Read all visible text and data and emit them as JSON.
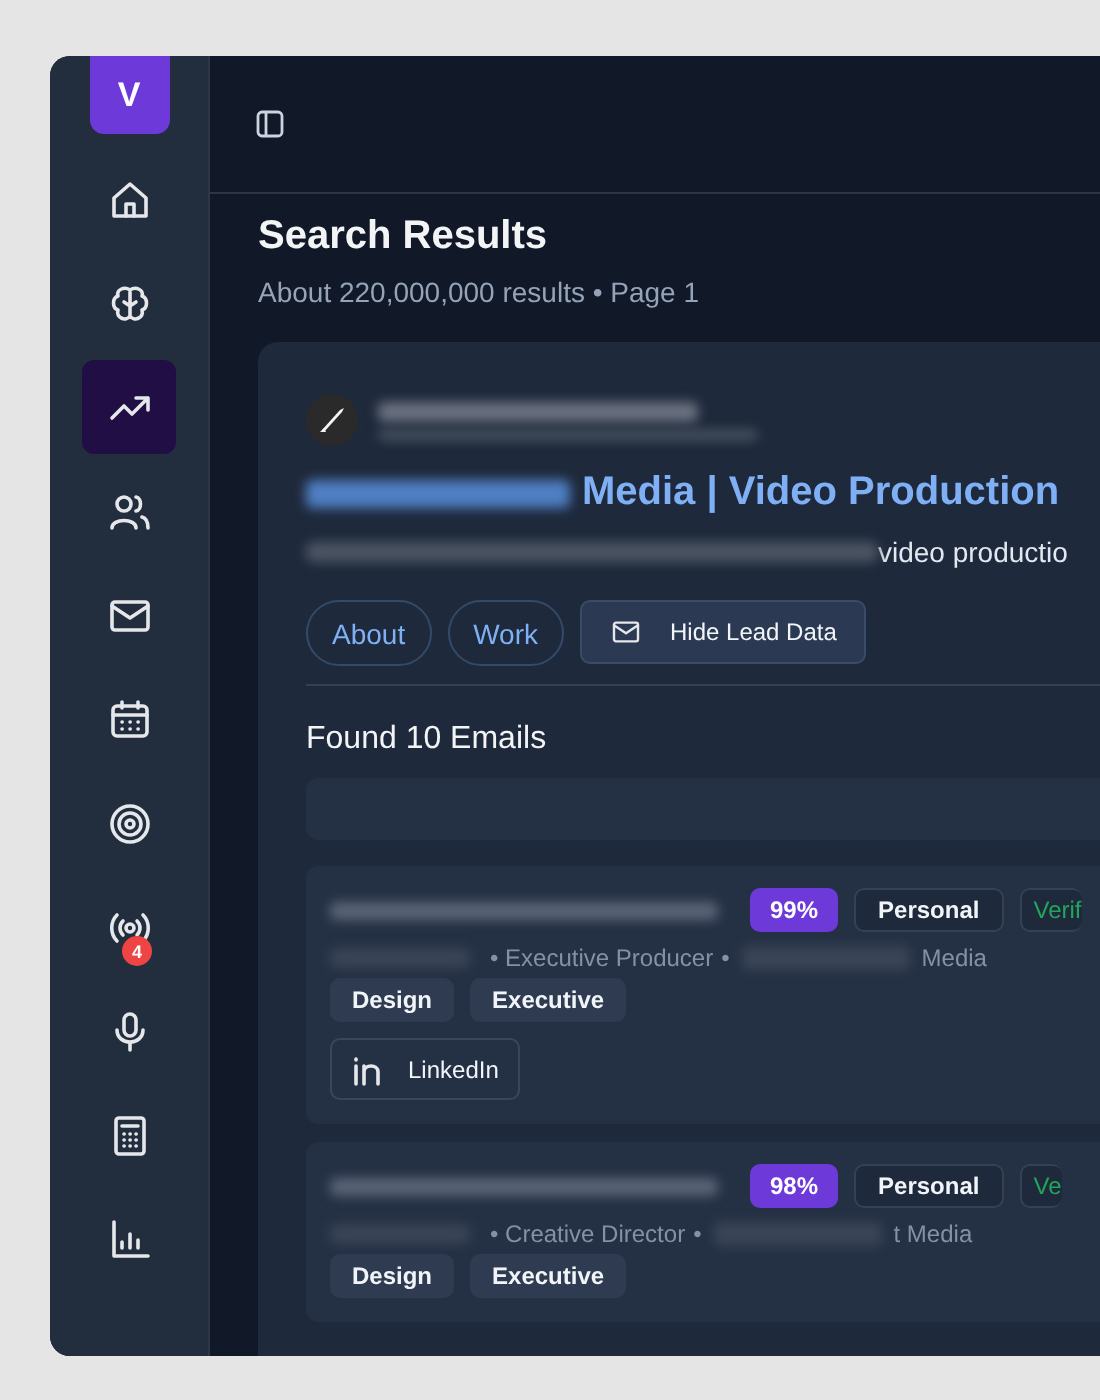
{
  "logo": "V",
  "sidebar": {
    "items": [
      {
        "selected": false
      },
      {
        "selected": false
      },
      {
        "selected": true
      },
      {
        "selected": false
      },
      {
        "selected": false
      },
      {
        "selected": false
      },
      {
        "selected": false
      },
      {
        "selected": false,
        "badge": "4"
      },
      {
        "selected": false
      },
      {
        "selected": false
      },
      {
        "selected": false
      }
    ]
  },
  "header": {
    "title": "Search Results",
    "subtitle": "About 220,000,000 results • Page 1"
  },
  "result": {
    "title": {
      "redacted_prefix": true,
      "text": "Media | Video Production"
    },
    "description": {
      "redacted_prefix": true,
      "text": "video productio"
    },
    "actions": [
      {
        "kind": "pill",
        "label": "About"
      },
      {
        "kind": "pill",
        "label": "Work"
      },
      {
        "kind": "button",
        "label": "Hide Lead Data"
      }
    ],
    "emails_heading": "Found 10 Emails",
    "emails": [
      {
        "score": "99%",
        "type": "Personal",
        "status": "Verif",
        "title": "• Executive Producer",
        "separator": "•",
        "company_suffix": "Media",
        "tags": [
          "Design",
          "Executive"
        ],
        "linkedin": "LinkedIn"
      },
      {
        "score": "98%",
        "type": "Personal",
        "status": "Ve",
        "title": "• Creative Director",
        "separator": "•",
        "company_suffix": "t Media",
        "tags": [
          "Design",
          "Executive"
        ]
      }
    ]
  }
}
